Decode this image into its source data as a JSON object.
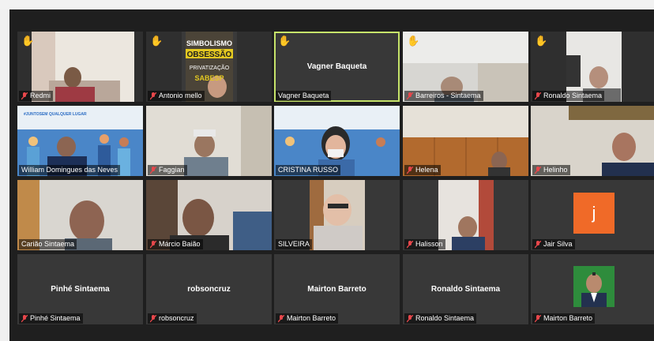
{
  "tiles": [
    {
      "name": "Redmi",
      "muted": true,
      "hand": true
    },
    {
      "name": "Antonio mello",
      "muted": true,
      "hand": true
    },
    {
      "name": "Vagner Baqueta",
      "muted": false,
      "hand": true,
      "center_name": "Vagner Baqueta",
      "active": true
    },
    {
      "name": "Barreiros - Sintaema",
      "muted": true,
      "hand": true
    },
    {
      "name": "Ronaldo Sintaema",
      "muted": true,
      "hand": true
    },
    {
      "name": "William Domingues das Neves",
      "muted": false,
      "hand": false
    },
    {
      "name": "Faggian",
      "muted": true,
      "hand": false
    },
    {
      "name": "CRISTINA RUSSO",
      "muted": false,
      "hand": false
    },
    {
      "name": "Helena",
      "muted": true,
      "hand": false
    },
    {
      "name": "Helinho",
      "muted": true,
      "hand": false
    },
    {
      "name": "Carião Sintaema",
      "muted": false,
      "hand": false
    },
    {
      "name": "Márcio Baião",
      "muted": true,
      "hand": false
    },
    {
      "name": "SILVEIRA",
      "muted": false,
      "hand": false
    },
    {
      "name": "Halisson",
      "muted": true,
      "hand": false
    },
    {
      "name": "Jair Silva",
      "muted": true,
      "hand": false,
      "avatar_letter": "j"
    },
    {
      "name": "Pinhé Sintaema",
      "muted": true,
      "hand": false,
      "center_name": "Pinhé Sintaema"
    },
    {
      "name": "robsoncruz",
      "muted": true,
      "hand": false,
      "center_name": "robsoncruz"
    },
    {
      "name": "Mairton Barreto",
      "muted": true,
      "hand": false,
      "center_name": "Mairton Barreto"
    },
    {
      "name": "Ronaldo Sintaema",
      "muted": true,
      "hand": false,
      "center_name": "Ronaldo Sintaema"
    },
    {
      "name": "Mairton Barreto",
      "muted": true,
      "hand": false
    }
  ],
  "screen_text": {
    "poster_1": "SIMBOLISMO",
    "poster_2": "OBSESSÃO",
    "poster_3": "PRIVATIZAÇÃO",
    "poster_4": "SABESP",
    "banner": "#JUNTOSEM QUALQUER LUGAR"
  },
  "colors": {
    "mute_red": "#e8474b",
    "hand_yellow": "#f4c24a",
    "active_border": "#c6e36a",
    "avatar_orange": "#f06a28"
  }
}
